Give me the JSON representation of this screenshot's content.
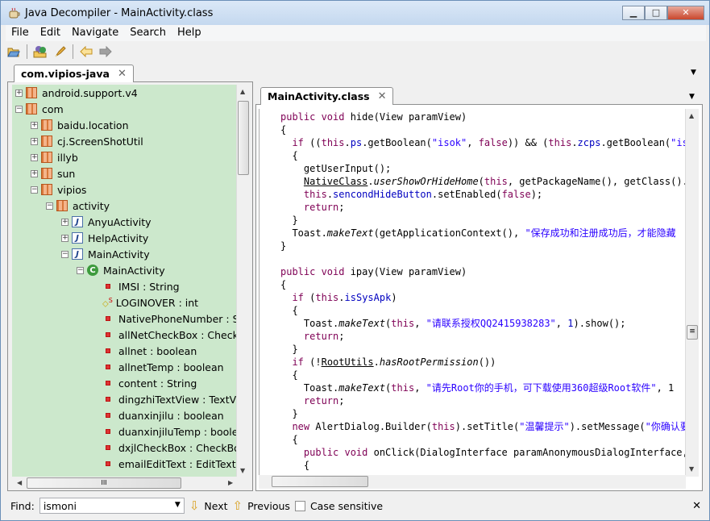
{
  "window": {
    "title": "Java Decompiler - MainActivity.class",
    "min": "▁",
    "max": "□",
    "close": "✕"
  },
  "menu": [
    "File",
    "Edit",
    "Navigate",
    "Search",
    "Help"
  ],
  "toolbar": {
    "icons": [
      "open-file-icon",
      "open-type-icon",
      "search-icon",
      "back-icon",
      "forward-icon"
    ]
  },
  "left_tab": {
    "label": "com.vipios-java",
    "close": "✕"
  },
  "tree": [
    {
      "level": 0,
      "exp": "+",
      "icon": "package",
      "label": "android.support.v4"
    },
    {
      "level": 0,
      "exp": "−",
      "icon": "package",
      "label": "com"
    },
    {
      "level": 1,
      "exp": "+",
      "icon": "package",
      "label": "baidu.location"
    },
    {
      "level": 1,
      "exp": "+",
      "icon": "package",
      "label": "cj.ScreenShotUtil"
    },
    {
      "level": 1,
      "exp": "+",
      "icon": "package",
      "label": "illyb"
    },
    {
      "level": 1,
      "exp": "+",
      "icon": "package",
      "label": "sun"
    },
    {
      "level": 1,
      "exp": "−",
      "icon": "package",
      "label": "vipios"
    },
    {
      "level": 2,
      "exp": "−",
      "icon": "package",
      "label": "activity"
    },
    {
      "level": 3,
      "exp": "+",
      "icon": "java",
      "label": "AnyuActivity"
    },
    {
      "level": 3,
      "exp": "+",
      "icon": "java",
      "label": "HelpActivity"
    },
    {
      "level": 3,
      "exp": "−",
      "icon": "java",
      "label": "MainActivity"
    },
    {
      "level": 4,
      "exp": "−",
      "icon": "class",
      "label": "MainActivity"
    },
    {
      "level": 5,
      "exp": "",
      "icon": "field",
      "label": "IMSI : String"
    },
    {
      "level": 5,
      "exp": "",
      "icon": "static-field",
      "label": "LOGINOVER : int"
    },
    {
      "level": 5,
      "exp": "",
      "icon": "field",
      "label": "NativePhoneNumber : St"
    },
    {
      "level": 5,
      "exp": "",
      "icon": "field",
      "label": "allNetCheckBox : CheckB"
    },
    {
      "level": 5,
      "exp": "",
      "icon": "field",
      "label": "allnet : boolean"
    },
    {
      "level": 5,
      "exp": "",
      "icon": "field",
      "label": "allnetTemp : boolean"
    },
    {
      "level": 5,
      "exp": "",
      "icon": "field",
      "label": "content : String"
    },
    {
      "level": 5,
      "exp": "",
      "icon": "field",
      "label": "dingzhiTextView : TextVi"
    },
    {
      "level": 5,
      "exp": "",
      "icon": "field",
      "label": "duanxinjilu : boolean"
    },
    {
      "level": 5,
      "exp": "",
      "icon": "field",
      "label": "duanxinjiluTemp : boolea"
    },
    {
      "level": 5,
      "exp": "",
      "icon": "field",
      "label": "dxjlCheckBox : CheckBox"
    },
    {
      "level": 5,
      "exp": "",
      "icon": "field",
      "label": "emailEditText : EditText"
    }
  ],
  "right_tab": {
    "label": "MainActivity.class",
    "close": "✕"
  },
  "code": [
    [
      [
        "kw",
        "public void "
      ],
      [
        "",
        "hide(View paramView)"
      ]
    ],
    [
      [
        "",
        "{"
      ]
    ],
    [
      [
        "",
        "  "
      ],
      [
        "kw",
        "if "
      ],
      [
        "",
        "(("
      ],
      [
        "kw",
        "this"
      ],
      [
        "",
        "."
      ],
      [
        "fl",
        "ps"
      ],
      [
        "",
        ".getBoolean("
      ],
      [
        "st",
        "\"isok\""
      ],
      [
        "",
        ", "
      ],
      [
        "kw",
        "false"
      ],
      [
        "",
        ")) && ("
      ],
      [
        "kw",
        "this"
      ],
      [
        "",
        "."
      ],
      [
        "fl",
        "zcps"
      ],
      [
        "",
        ".getBoolean("
      ],
      [
        "st",
        "\"isok"
      ]
    ],
    [
      [
        "",
        "  {"
      ]
    ],
    [
      [
        "",
        "    getUserInput();"
      ]
    ],
    [
      [
        "",
        "    "
      ],
      [
        "un",
        "NativeClass"
      ],
      [
        "",
        "."
      ],
      [
        "it",
        "userShowOrHideHome"
      ],
      [
        "",
        "("
      ],
      [
        "kw",
        "this"
      ],
      [
        "",
        ", getPackageName(), getClass().getN"
      ]
    ],
    [
      [
        "",
        "    "
      ],
      [
        "kw",
        "this"
      ],
      [
        "",
        "."
      ],
      [
        "fl",
        "sencondHideButton"
      ],
      [
        "",
        ".setEnabled("
      ],
      [
        "kw",
        "false"
      ],
      [
        "",
        ");"
      ]
    ],
    [
      [
        "",
        "    "
      ],
      [
        "kw",
        "return"
      ],
      [
        "",
        ";"
      ]
    ],
    [
      [
        "",
        "  }"
      ]
    ],
    [
      [
        "",
        "  Toast."
      ],
      [
        "it",
        "makeText"
      ],
      [
        "",
        "(getApplicationContext(), "
      ],
      [
        "st",
        "\"保存成功和注册成功后，才能隐藏"
      ]
    ],
    [
      [
        "",
        "}"
      ]
    ],
    [
      [
        "",
        ""
      ]
    ],
    [
      [
        "kw",
        "public void "
      ],
      [
        "",
        "ipay(View paramView)"
      ]
    ],
    [
      [
        "",
        "{"
      ]
    ],
    [
      [
        "",
        "  "
      ],
      [
        "kw",
        "if "
      ],
      [
        "",
        "("
      ],
      [
        "kw",
        "this"
      ],
      [
        "",
        "."
      ],
      [
        "fl",
        "isSysApk"
      ],
      [
        "",
        ")"
      ]
    ],
    [
      [
        "",
        "  {"
      ]
    ],
    [
      [
        "",
        "    Toast."
      ],
      [
        "it",
        "makeText"
      ],
      [
        "",
        "("
      ],
      [
        "kw",
        "this"
      ],
      [
        "",
        ", "
      ],
      [
        "st",
        "\"请联系授权QQ2415938283\""
      ],
      [
        "",
        ", "
      ],
      [
        "fl",
        "1"
      ],
      [
        "",
        ").show();"
      ]
    ],
    [
      [
        "",
        "    "
      ],
      [
        "kw",
        "return"
      ],
      [
        "",
        ";"
      ]
    ],
    [
      [
        "",
        "  }"
      ]
    ],
    [
      [
        "",
        "  "
      ],
      [
        "kw",
        "if "
      ],
      [
        "",
        "(!"
      ],
      [
        "un",
        "RootUtils"
      ],
      [
        "",
        "."
      ],
      [
        "it",
        "hasRootPermission"
      ],
      [
        "",
        "())"
      ]
    ],
    [
      [
        "",
        "  {"
      ]
    ],
    [
      [
        "",
        "    Toast."
      ],
      [
        "it",
        "makeText"
      ],
      [
        "",
        "("
      ],
      [
        "kw",
        "this"
      ],
      [
        "",
        ", "
      ],
      [
        "st",
        "\"请先Root你的手机，可下载使用360超级Root软件\""
      ],
      [
        "",
        ", 1"
      ]
    ],
    [
      [
        "",
        "    "
      ],
      [
        "kw",
        "return"
      ],
      [
        "",
        ";"
      ]
    ],
    [
      [
        "",
        "  }"
      ]
    ],
    [
      [
        "",
        "  "
      ],
      [
        "kw",
        "new "
      ],
      [
        "",
        "AlertDialog.Builder("
      ],
      [
        "kw",
        "this"
      ],
      [
        "",
        ").setTitle("
      ],
      [
        "st",
        "\"温馨提示\""
      ],
      [
        "",
        ").setMessage("
      ],
      [
        "st",
        "\"你确认要"
      ]
    ],
    [
      [
        "",
        "  {"
      ]
    ],
    [
      [
        "",
        "    "
      ],
      [
        "kw",
        "public void "
      ],
      [
        "",
        "onClick(DialogInterface paramAnonymousDialogInterface, in"
      ]
    ],
    [
      [
        "",
        "    {"
      ]
    ]
  ],
  "find": {
    "label": "Find:",
    "value": "ismoni",
    "next": "Next",
    "previous": "Previous",
    "case_sensitive": "Case sensitive",
    "case_checked": false,
    "close": "✕"
  }
}
